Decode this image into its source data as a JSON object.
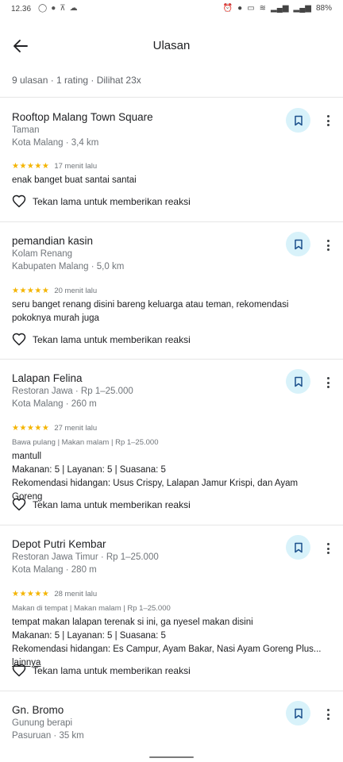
{
  "status_bar": {
    "time": "12.36",
    "battery": "88%"
  },
  "app_bar": {
    "title": "Ulasan"
  },
  "summary": "9 ulasan · 1 rating · Dilihat 23x",
  "react_label": "Tekan lama untuk memberikan reaksi",
  "reviews": [
    {
      "name": "Rooftop Malang Town Square",
      "category": "Taman",
      "location": "Kota Malang · 3,4 km",
      "stars": "★★★★★",
      "time": "17 menit lalu",
      "text": "enak banget buat santai santai"
    },
    {
      "name": "pemandian kasin",
      "category": "Kolam Renang",
      "location": "Kabupaten Malang · 5,0 km",
      "stars": "★★★★★",
      "time": "20 menit lalu",
      "text": "seru banget renang disini bareng keluarga atau teman, rekomendasi pokoknya murah juga"
    },
    {
      "name": "Lalapan Felina",
      "category": "Restoran Jawa · Rp 1–25.000",
      "location": "Kota Malang · 260 m",
      "stars": "★★★★★",
      "time": "27 menit lalu",
      "tags": "Bawa pulang | Makan malam | Rp 1–25.000",
      "text": "mantull",
      "ratings_line": "Makanan: 5 | Layanan: 5 | Suasana: 5",
      "recommend_label": "Rekomendasi hidangan:",
      "recommend_value": " Usus Crispy, Lalapan Jamur Krispi, dan Ayam Goreng"
    },
    {
      "name": "Depot Putri Kembar",
      "category": "Restoran Jawa Timur · Rp 1–25.000",
      "location": "Kota Malang · 280 m",
      "stars": "★★★★★",
      "time": "28 menit lalu",
      "tags": "Makan di tempat | Makan malam | Rp 1–25.000",
      "text": "tempat makan lalapan terenak si ini, ga nyesel makan disini",
      "ratings_line": "Makanan: 5 | Layanan: 5 | Suasana: 5",
      "recommend_label": "Rekomendasi hidangan:",
      "recommend_value": " Es Campur, Ayam Bakar, Nasi Ayam Goreng Plus...",
      "more_link": "lainnya"
    },
    {
      "name": "Gn. Bromo",
      "category": "Gunung berapi",
      "location": "Pasuruan · 35 km"
    }
  ],
  "colors": {
    "star": "#f4b400",
    "bookmark_bg": "#d8f2fa"
  }
}
